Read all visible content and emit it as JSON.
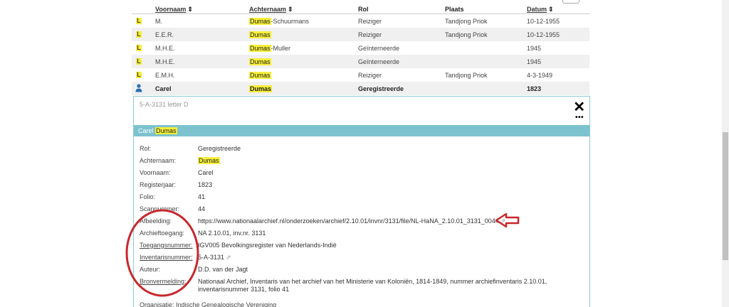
{
  "table": {
    "headers": {
      "voornaam": "Voornaam",
      "achternaam": "Achternaam",
      "rol": "Rol",
      "plaats": "Plaats",
      "datum": "Datum",
      "sort_glyph": "⇕"
    },
    "rows": [
      {
        "icon": "L",
        "voornaam": "M.",
        "achternaam_hl": "Dumas",
        "achternaam_rest": "-Schuurmans",
        "rol": "Reiziger",
        "plaats": "Tandjong Priok",
        "datum": "10-12-1955"
      },
      {
        "icon": "L",
        "voornaam": "E.E.R.",
        "achternaam_hl": "Dumas",
        "achternaam_rest": "",
        "rol": "Reiziger",
        "plaats": "Tandjong Priok",
        "datum": "10-12-1955"
      },
      {
        "icon": "L",
        "voornaam": "M.H.E.",
        "achternaam_hl": "Dumas",
        "achternaam_rest": "-Muller",
        "rol": "Geïnterneerde",
        "plaats": "",
        "datum": "1945"
      },
      {
        "icon": "L",
        "voornaam": "M.H.E.",
        "achternaam_hl": "Dumas",
        "achternaam_rest": "",
        "rol": "Geïnterneerde",
        "plaats": "",
        "datum": "1945"
      },
      {
        "icon": "L",
        "voornaam": "E.M.H.",
        "achternaam_hl": "Dumas",
        "achternaam_rest": "",
        "rol": "Reiziger",
        "plaats": "Tandjong Priok",
        "datum": "4-3-1949"
      },
      {
        "icon": "person-icon",
        "voornaam": "Carel",
        "achternaam_hl": "Dumas",
        "achternaam_rest": "",
        "rol": "Geregistreerde",
        "plaats": "",
        "datum": "1823"
      }
    ]
  },
  "detail": {
    "reference": "5-A-3131 letter D",
    "close_glyph": "✕",
    "more_glyph": "•••",
    "name_first": "Carel",
    "name_last": "Dumas",
    "fields": [
      {
        "label": "Rol:",
        "value": "Geregistreerde"
      },
      {
        "label": "Achternaam:",
        "value": "Dumas"
      },
      {
        "label": "Voornaam:",
        "value": "Carel"
      },
      {
        "label": "Registerjaar:",
        "value": "1823"
      },
      {
        "label": "Folio:",
        "value": "41"
      },
      {
        "label": "Scannummer:",
        "value": "44"
      },
      {
        "label": "Afbeelding:",
        "value": "https://www.nationaalarchief.nl/onderzoeken/archief/2.10.01/invnr/3131/file/NL-HaNA_2.10.01_3131_0044"
      },
      {
        "label": "Archieftoegang:",
        "value": "NA 2.10.01, inv.nr. 3131"
      },
      {
        "label": "Toegangsnummer:",
        "value": "IGV005 Bevolkingsregister van Nederlands-Indië"
      },
      {
        "label": "Inventarisnummer:",
        "value": "5-A-3131"
      },
      {
        "label": "Auteur:",
        "value": "D.D. van der Jagt"
      },
      {
        "label": "Bronvermelding:",
        "value": "Nationaal Archief, Inventaris van het archief van het Ministerie van Koloniën, 1814-1849, nummer archiefinventaris 2.10.01, inventarisnummer 3131, folio 41"
      }
    ],
    "organisatie": "Organisatie: Indische Genealogische Vereniging",
    "external_glyph": "⇗"
  },
  "colors": {
    "highlight": "#f7ef3a",
    "band": "#7cc3cf",
    "annotation_red": "#c8282d"
  }
}
